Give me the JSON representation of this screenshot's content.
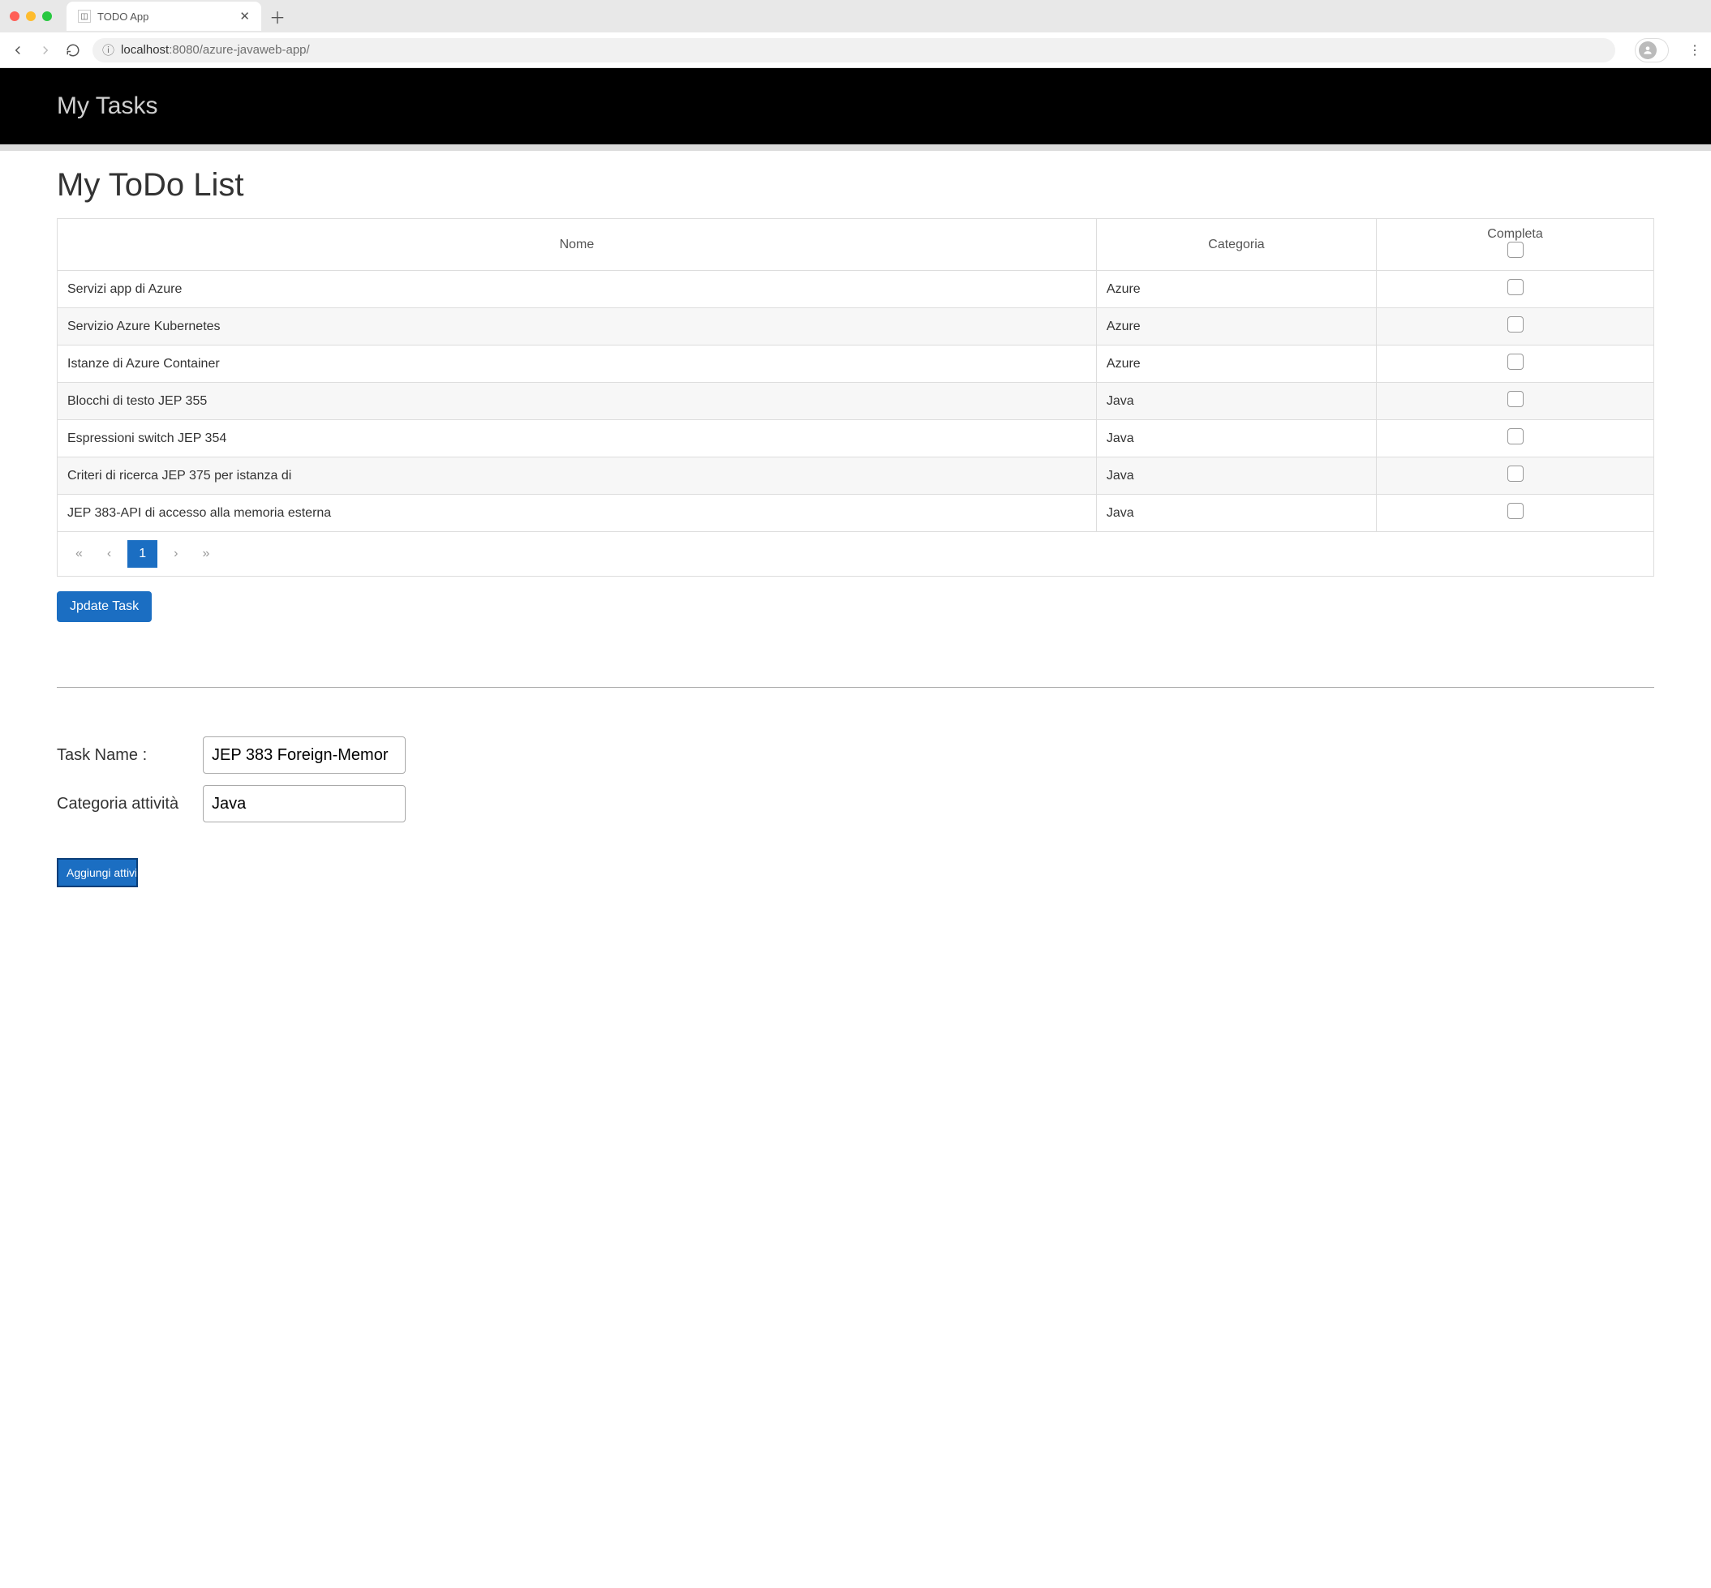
{
  "browser": {
    "tab_title": "TODO App",
    "address_host": "localhost",
    "address_port": ":8080",
    "address_path": "/azure-javaweb-app/"
  },
  "banner": {
    "title": "My Tasks"
  },
  "page": {
    "title": "My ToDo List"
  },
  "table": {
    "headers": {
      "name": "Nome",
      "category": "Categoria",
      "complete": "Completa"
    },
    "rows": [
      {
        "name": "Servizi app di Azure",
        "category": "Azure",
        "complete": false
      },
      {
        "name": "Servizio Azure Kubernetes",
        "category": "Azure",
        "complete": false
      },
      {
        "name": "Istanze di Azure Container",
        "category": "Azure",
        "complete": false
      },
      {
        "name": "Blocchi di testo JEP 355",
        "category": "Java",
        "complete": false
      },
      {
        "name": "Espressioni switch JEP 354",
        "category": "Java",
        "complete": false
      },
      {
        "name": "Criteri di ricerca JEP 375 per istanza di",
        "category": "Java",
        "complete": false
      },
      {
        "name": "JEP 383-API di accesso alla memoria esterna",
        "category": "Java",
        "complete": false
      }
    ],
    "page_current": "1"
  },
  "buttons": {
    "update": "Jpdate Task",
    "add": "Aggiungi attività"
  },
  "form": {
    "task_name_label": "Task Name :",
    "task_name_value": "JEP 383 Foreign-Memor",
    "task_category_label": "Categoria attività",
    "task_category_value": "Java"
  }
}
